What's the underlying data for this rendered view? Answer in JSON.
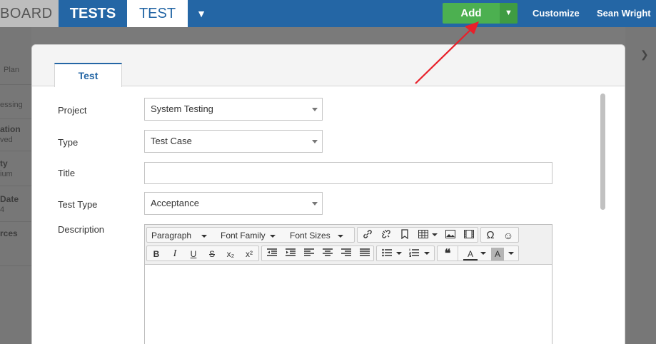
{
  "topbar": {
    "tabs": [
      {
        "label": "BOARD"
      },
      {
        "label": "TESTS"
      },
      {
        "label": "TEST"
      }
    ],
    "add_label": "Add",
    "customize_label": "Customize",
    "user_name": "Sean Wright"
  },
  "background": {
    "side_labels": [
      "Plan",
      "essing",
      "ation",
      "ved",
      "ty",
      "ium",
      "Date",
      "4",
      "rces"
    ]
  },
  "modal": {
    "tab_label": "Test",
    "fields": {
      "project": {
        "label": "Project",
        "value": "System Testing"
      },
      "type": {
        "label": "Type",
        "value": "Test Case"
      },
      "title": {
        "label": "Title",
        "value": ""
      },
      "test_type": {
        "label": "Test Type",
        "value": "Acceptance"
      },
      "description": {
        "label": "Description"
      }
    },
    "editor": {
      "format_dropdown": "Paragraph",
      "font_family_dropdown": "Font Family",
      "font_size_dropdown": "Font Sizes",
      "bold": "B",
      "italic": "I",
      "underline": "U",
      "strike": "S",
      "subscript": "x₂",
      "superscript": "x²",
      "font_color": "A",
      "bg_color": "A",
      "quote": "❝"
    }
  },
  "colors": {
    "topbar_blue": "#2466a5",
    "add_green": "#4cb050",
    "arrow_red": "#e8202a"
  }
}
